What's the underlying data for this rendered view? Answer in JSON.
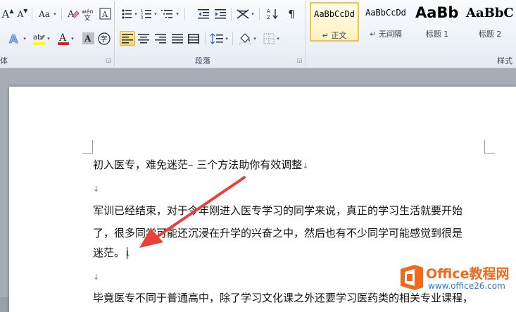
{
  "ribbon": {
    "font_group": {
      "label": "体",
      "grow_font": "A",
      "shrink_font": "A",
      "change_case": "Aa",
      "clear_format_label": "A",
      "pinyin_label": "wén",
      "text_highlight_color": "#ffff00",
      "font_color_value": "#e02020",
      "char_shading_label": "A",
      "enclose_char_label": "字"
    },
    "paragraph_group": {
      "label": "段落"
    },
    "styles_group": {
      "label": "样式",
      "styles": [
        {
          "sample": "AaBbCcDd",
          "name": "↵ 正文",
          "selected": true
        },
        {
          "sample": "AaBbCcDd",
          "name": "↵ 无间隔",
          "selected": false
        },
        {
          "sample": "AaBb",
          "name": "标题 1",
          "selected": false
        },
        {
          "sample": "AaBbC",
          "name": "标题 2",
          "selected": false
        }
      ]
    }
  },
  "document": {
    "lines": [
      {
        "text": "初入医专，难免迷茫–  三个方法助你有效调整",
        "mark": "↓"
      },
      {
        "text": "",
        "mark": "↓"
      },
      {
        "text": "军训已经结束，对于今年刚进入医专学习的同学来说，真正的学习生活就要开始",
        "mark": ""
      },
      {
        "text": "了，很多同学可能还沉浸在升学的兴奋之中，然后也有不少同学可能感觉到很是",
        "mark": ""
      },
      {
        "text": "迷茫。",
        "mark": "↓"
      },
      {
        "text": "",
        "mark": "↓"
      },
      {
        "text": "毕竟医专不同于普通高中，除了学习文化课之外还要学习医药类的相关专业课程，",
        "mark": ""
      }
    ]
  },
  "annotation": {
    "arrow_color": "#e8403a"
  },
  "watermark": {
    "brand": "Office教程网",
    "url": "www.office26.com"
  }
}
